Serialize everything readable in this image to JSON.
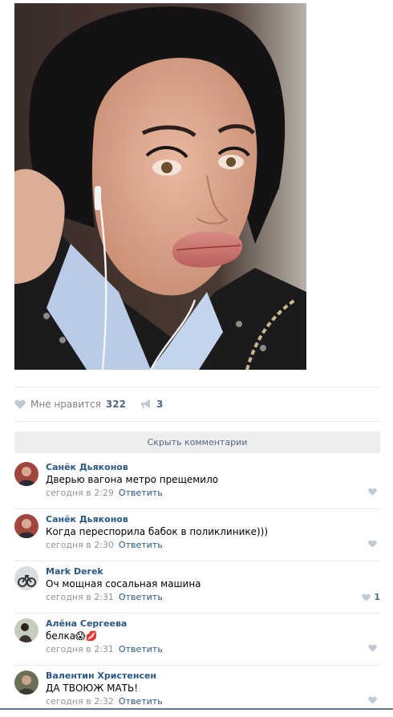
{
  "colors": {
    "accent": "#2a5885",
    "muted": "#939393",
    "divider": "#e7e8ec",
    "button_bg": "#edeef0"
  },
  "post": {
    "photo_icon": "selfie-photo",
    "likes_label": "Мне нравится",
    "likes_count": "322",
    "shares_count": "3"
  },
  "hide_comments_label": "Скрыть комментарии",
  "comments": [
    {
      "author": "Санёк Дьяконов",
      "text": "Дверью вагона метро прещемило",
      "time": "сегодня в 2:29",
      "reply": "Ответить",
      "likes": ""
    },
    {
      "author": "Санёк Дьяконов",
      "text": "Когда переспорила бабок в поликлинике)))",
      "time": "сегодня в 2:30",
      "reply": "Ответить",
      "likes": ""
    },
    {
      "author": "Mark Derek",
      "text": "Оч мощная сосальная машина",
      "time": "сегодня в 2:31",
      "reply": "Ответить",
      "likes": "1"
    },
    {
      "author": "Алёна Сергеева",
      "text": "белка😱💋",
      "time": "сегодня в 2:31",
      "reply": "Ответить",
      "likes": ""
    },
    {
      "author": "Валентин Христенсен",
      "text": "ДА ТВОЮЖ МАТЬ!",
      "time": "сегодня в 2:32",
      "reply": "Ответить",
      "likes": ""
    }
  ]
}
